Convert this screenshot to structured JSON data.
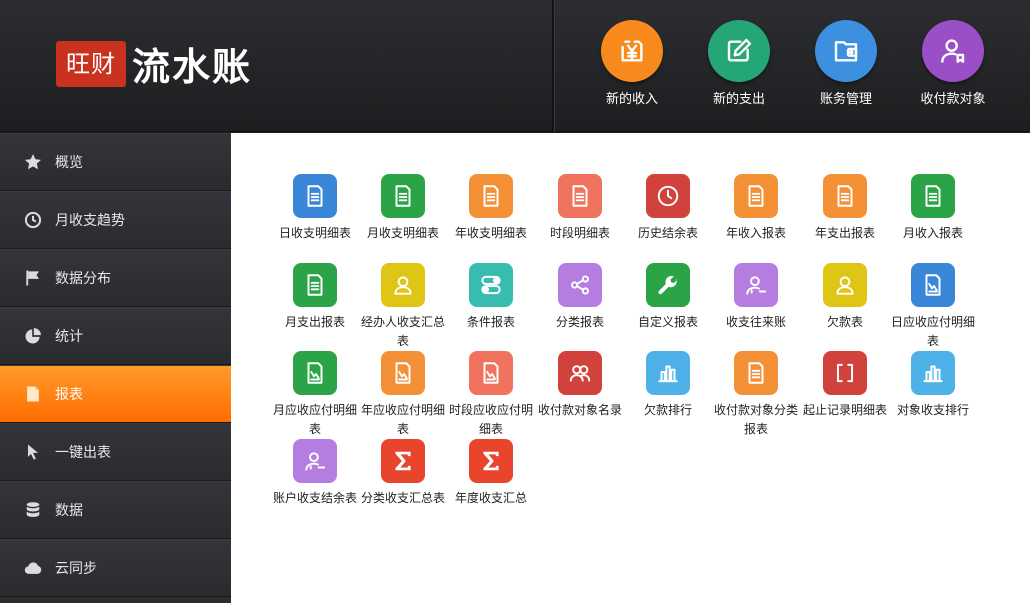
{
  "app": {
    "logo_badge": "旺财",
    "logo_text": "流水账"
  },
  "header_buttons": [
    {
      "label": "新的收入",
      "color": "#f7891d",
      "icon": "yen-document-icon"
    },
    {
      "label": "新的支出",
      "color": "#25a676",
      "icon": "pencil-edit-icon"
    },
    {
      "label": "账务管理",
      "color": "#3d8fe0",
      "icon": "wallet-icon"
    },
    {
      "label": "收付款对象",
      "color": "#9a4fc7",
      "icon": "user-tag-icon"
    }
  ],
  "sidebar": {
    "items": [
      {
        "label": "概览",
        "icon": "star-icon"
      },
      {
        "label": "月收支趋势",
        "icon": "clock-icon"
      },
      {
        "label": "数据分布",
        "icon": "flag-icon"
      },
      {
        "label": "统计",
        "icon": "pie-chart-icon"
      },
      {
        "label": "报表",
        "icon": "document-icon",
        "active": true
      },
      {
        "label": "一键出表",
        "icon": "cursor-icon"
      },
      {
        "label": "数据",
        "icon": "database-icon"
      },
      {
        "label": "云同步",
        "icon": "cloud-icon"
      }
    ]
  },
  "reports": [
    {
      "label": "日收支明细表",
      "color": "#3a86d8",
      "icon": "document-icon"
    },
    {
      "label": "月收支明细表",
      "color": "#2aa446",
      "icon": "document-icon"
    },
    {
      "label": "年收支明细表",
      "color": "#f49036",
      "icon": "document-icon"
    },
    {
      "label": "时段明细表",
      "color": "#f0735d",
      "icon": "document-icon"
    },
    {
      "label": "历史结余表",
      "color": "#d2423c",
      "icon": "clock-icon"
    },
    {
      "label": "年收入报表",
      "color": "#f49036",
      "icon": "document-icon"
    },
    {
      "label": "年支出报表",
      "color": "#f49036",
      "icon": "document-icon"
    },
    {
      "label": "月收入报表",
      "color": "#2aa446",
      "icon": "document-icon"
    },
    {
      "label": "月支出报表",
      "color": "#2aa446",
      "icon": "document-icon"
    },
    {
      "label": "经办人收支汇总表",
      "color": "#e0c614",
      "icon": "person-icon"
    },
    {
      "label": "条件报表",
      "color": "#39bcb0",
      "icon": "toggle-icon"
    },
    {
      "label": "分类报表",
      "color": "#b57de0",
      "icon": "share-icon"
    },
    {
      "label": "自定义报表",
      "color": "#2aa446",
      "icon": "wrench-icon"
    },
    {
      "label": "收支往来账",
      "color": "#b57de0",
      "icon": "person-minus-icon"
    },
    {
      "label": "欠款表",
      "color": "#e0c614",
      "icon": "person-icon"
    },
    {
      "label": "日应收应付明细表",
      "color": "#3a86d8",
      "icon": "chart-document-icon"
    },
    {
      "label": "月应收应付明细表",
      "color": "#2aa446",
      "icon": "chart-document-icon"
    },
    {
      "label": "年应收应付明细表",
      "color": "#f49036",
      "icon": "chart-document-icon"
    },
    {
      "label": "时段应收应付明细表",
      "color": "#f0735d",
      "icon": "chart-document-icon"
    },
    {
      "label": "收付款对象名录",
      "color": "#d2423c",
      "icon": "people-icon"
    },
    {
      "label": "欠款排行",
      "color": "#4eb2e8",
      "icon": "bar-chart-icon"
    },
    {
      "label": "收付款对象分类报表",
      "color": "#f49036",
      "icon": "document-icon"
    },
    {
      "label": "起止记录明细表",
      "color": "#d2423c",
      "icon": "brackets-icon"
    },
    {
      "label": "对象收支排行",
      "color": "#4eb2e8",
      "icon": "bar-chart-icon"
    },
    {
      "label": "账户收支结余表",
      "color": "#b57de0",
      "icon": "person-minus-icon"
    },
    {
      "label": "分类收支汇总表",
      "color": "#e8452c",
      "icon": "sigma-icon"
    },
    {
      "label": "年度收支汇总",
      "color": "#e8452c",
      "icon": "sigma-icon"
    }
  ]
}
